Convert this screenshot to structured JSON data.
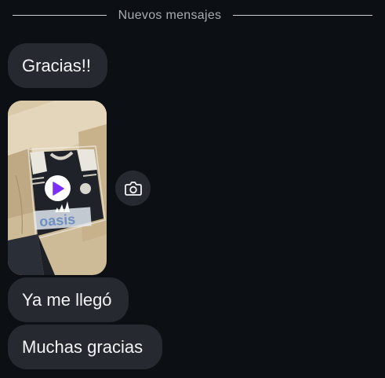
{
  "divider": {
    "label": "Nuevos mensajes"
  },
  "messages": [
    {
      "text": "Gracias!!"
    },
    {
      "text": "Ya me llegó"
    },
    {
      "text": "Muchas gracias"
    }
  ],
  "media": {
    "icon": "play-icon",
    "reply_icon": "camera-icon",
    "play_color": "#7b2ff7"
  },
  "colors": {
    "background": "#0c1014",
    "bubble": "#262a30",
    "text": "#f2f3f5"
  }
}
